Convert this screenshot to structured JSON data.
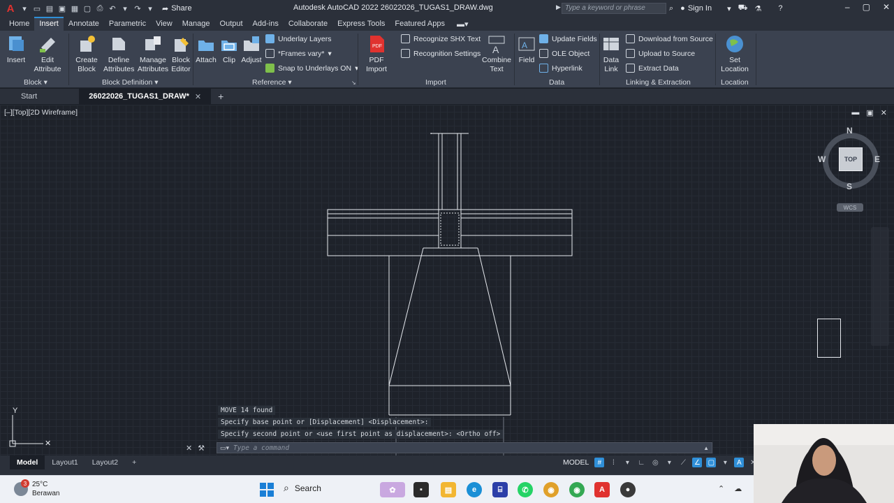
{
  "app": {
    "title": "Autodesk AutoCAD 2022   26022026_TUGAS1_DRAW.dwg",
    "logo": "A",
    "share_label": "Share",
    "search_placeholder": "Type a keyword or phrase",
    "sign_in": "Sign In"
  },
  "ribbon_tabs": [
    "Home",
    "Insert",
    "Annotate",
    "Parametric",
    "View",
    "Manage",
    "Output",
    "Add-ins",
    "Collaborate",
    "Express Tools",
    "Featured Apps"
  ],
  "active_tab": "Insert",
  "ribbon": {
    "block": {
      "insert": "Insert",
      "edit_attribute": "Edit Attribute",
      "panel": "Block"
    },
    "block_definition": {
      "create_block": "Create Block",
      "define_attributes": "Define Attributes",
      "manage_attributes": "Manage Attributes",
      "block_editor": "Block Editor",
      "panel": "Block Definition"
    },
    "reference": {
      "attach": "Attach",
      "clip": "Clip",
      "adjust": "Adjust",
      "underlay_layers": "Underlay Layers",
      "frames_vary": "*Frames vary*",
      "snap_underlays": "Snap to Underlays ON",
      "panel": "Reference"
    },
    "import": {
      "pdf_import": "PDF Import",
      "recognize_shx": "Recognize SHX Text",
      "recognition_settings": "Recognition Settings",
      "combine_text": "Combine Text",
      "panel": "Import"
    },
    "data": {
      "field": "Field",
      "update_fields": "Update Fields",
      "ole_object": "OLE Object",
      "hyperlink": "Hyperlink",
      "panel": "Data"
    },
    "linking": {
      "data_link": "Data Link",
      "download_source": "Download from Source",
      "upload_source": "Upload to Source",
      "extract_data": "Extract  Data",
      "panel": "Linking & Extraction"
    },
    "location": {
      "set_location": "Set Location",
      "panel": "Location"
    }
  },
  "doc_tabs": {
    "start": "Start",
    "active": "26022026_TUGAS1_DRAW*"
  },
  "viewport": {
    "label": "[–][Top][2D Wireframe]",
    "viewcube": {
      "top": "TOP",
      "north": "N",
      "south": "S",
      "east": "E",
      "west": "W",
      "wcs": "WCS"
    }
  },
  "command": {
    "history": [
      "MOVE 14 found",
      "Specify base point or [Displacement] <Displacement>:",
      "Specify second point or <use first point as displacement>:  <Ortho off>"
    ],
    "placeholder": "Type a command"
  },
  "ucs": {
    "y": "Y"
  },
  "layout_tabs": [
    "Model",
    "Layout1",
    "Layout2"
  ],
  "status": {
    "model": "MODEL"
  },
  "taskbar": {
    "weather_temp": "25°C",
    "weather_desc": "Berawan",
    "weather_badge": "3",
    "search_label": "Search"
  },
  "colors": {
    "accent": "#2f8fd8",
    "ribbon_bg": "#3b4250",
    "canvas_bg": "#1e222a",
    "autocad_red": "#e0322f"
  }
}
